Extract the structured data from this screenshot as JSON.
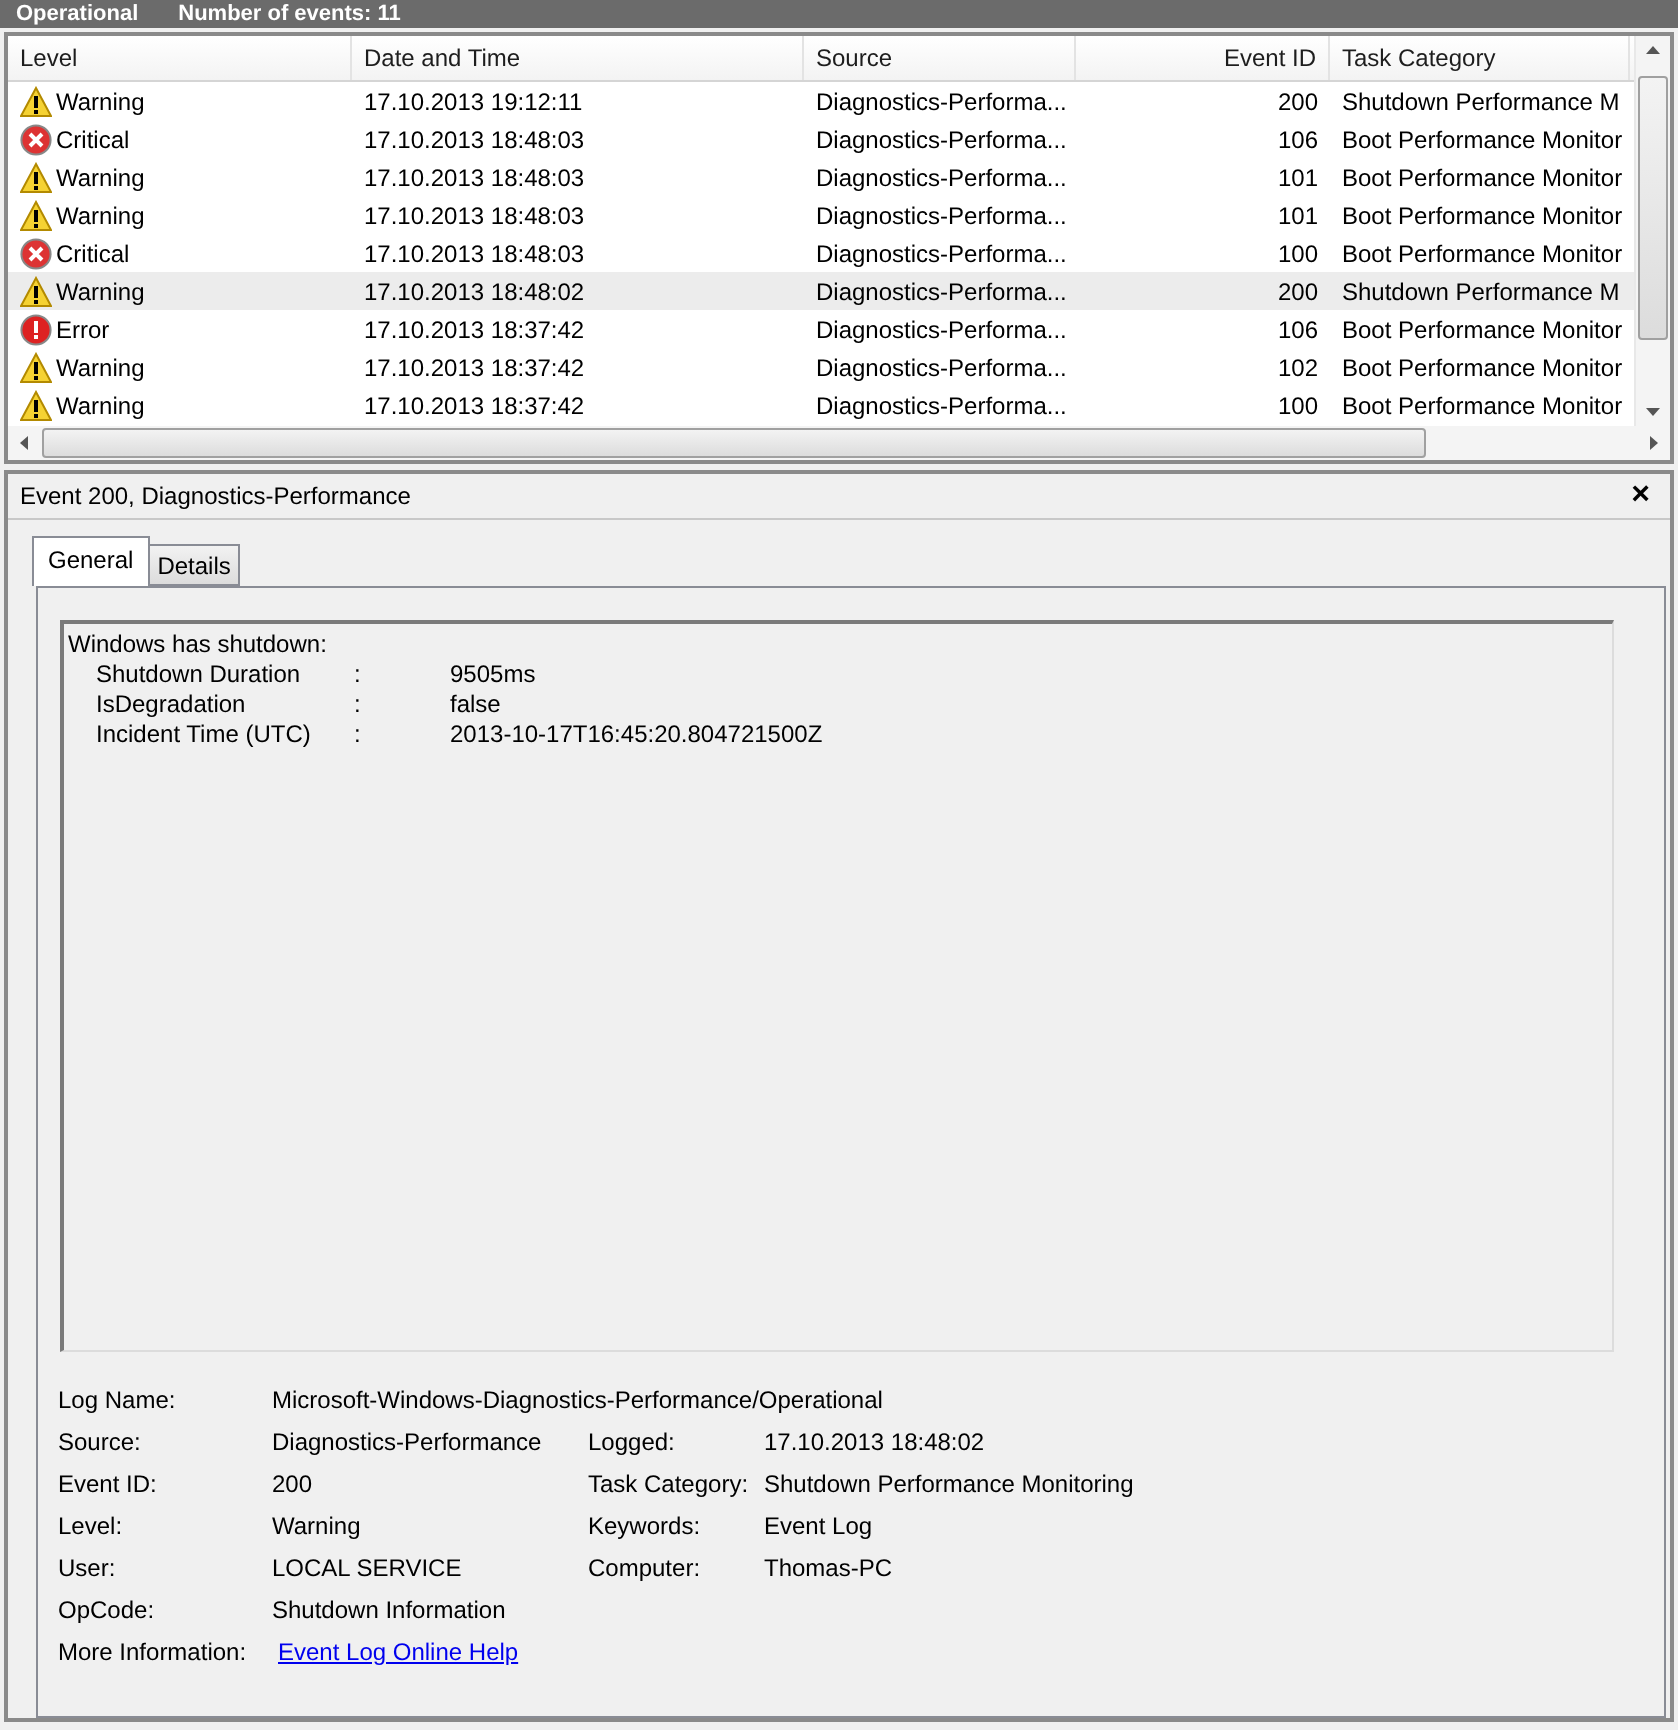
{
  "header": {
    "title": "Operational",
    "count": "Number of events: 11"
  },
  "table": {
    "columns": [
      {
        "label": "Level"
      },
      {
        "label": "Date and Time"
      },
      {
        "label": "Source"
      },
      {
        "label": "Event ID"
      },
      {
        "label": "Task Category"
      }
    ],
    "rows": [
      {
        "kind": "warning",
        "level": "Warning",
        "date": "17.10.2013 19:12:11",
        "source": "Diagnostics-Performa...",
        "id": "200",
        "task": "Shutdown Performance M",
        "selected": false
      },
      {
        "kind": "critical",
        "level": "Critical",
        "date": "17.10.2013 18:48:03",
        "source": "Diagnostics-Performa...",
        "id": "106",
        "task": "Boot Performance Monitor",
        "selected": false
      },
      {
        "kind": "warning",
        "level": "Warning",
        "date": "17.10.2013 18:48:03",
        "source": "Diagnostics-Performa...",
        "id": "101",
        "task": "Boot Performance Monitor",
        "selected": false
      },
      {
        "kind": "warning",
        "level": "Warning",
        "date": "17.10.2013 18:48:03",
        "source": "Diagnostics-Performa...",
        "id": "101",
        "task": "Boot Performance Monitor",
        "selected": false
      },
      {
        "kind": "critical",
        "level": "Critical",
        "date": "17.10.2013 18:48:03",
        "source": "Diagnostics-Performa...",
        "id": "100",
        "task": "Boot Performance Monitor",
        "selected": false
      },
      {
        "kind": "warning",
        "level": "Warning",
        "date": "17.10.2013 18:48:02",
        "source": "Diagnostics-Performa...",
        "id": "200",
        "task": "Shutdown Performance M",
        "selected": true
      },
      {
        "kind": "error",
        "level": "Error",
        "date": "17.10.2013 18:37:42",
        "source": "Diagnostics-Performa...",
        "id": "106",
        "task": "Boot Performance Monitor",
        "selected": false
      },
      {
        "kind": "warning",
        "level": "Warning",
        "date": "17.10.2013 18:37:42",
        "source": "Diagnostics-Performa...",
        "id": "102",
        "task": "Boot Performance Monitor",
        "selected": false
      },
      {
        "kind": "warning",
        "level": "Warning",
        "date": "17.10.2013 18:37:42",
        "source": "Diagnostics-Performa...",
        "id": "100",
        "task": "Boot Performance Monitor",
        "selected": false
      }
    ]
  },
  "detail": {
    "title": "Event 200, Diagnostics-Performance",
    "close": "×",
    "tabs": [
      {
        "label": "General",
        "selected": true
      },
      {
        "label": "Details",
        "selected": false
      }
    ],
    "message": {
      "heading": "Windows has shutdown:",
      "lines": [
        {
          "name": "Shutdown Duration",
          "sep": ":",
          "value": "9505ms"
        },
        {
          "name": "IsDegradation",
          "sep": ":",
          "value": "false"
        },
        {
          "name": "Incident Time (UTC)",
          "sep": ":",
          "value": "2013-10-17T16:45:20.804721500Z"
        }
      ]
    },
    "properties": [
      {
        "label": "Log Name:",
        "value": "Microsoft-Windows-Diagnostics-Performance/Operational"
      },
      {
        "label": "Source:",
        "value": "Diagnostics-Performance",
        "label2": "Logged:",
        "value2": "17.10.2013 18:48:02"
      },
      {
        "label": "Event ID:",
        "value": "200",
        "label2": "Task Category:",
        "value2": "Shutdown Performance Monitoring"
      },
      {
        "label": "Level:",
        "value": "Warning",
        "label2": "Keywords:",
        "value2": "Event Log"
      },
      {
        "label": "User:",
        "value": "LOCAL SERVICE",
        "label2": "Computer:",
        "value2": "Thomas-PC"
      },
      {
        "label": "OpCode:",
        "value": "Shutdown Information"
      },
      {
        "label": "More Information:",
        "link": "Event Log Online Help"
      }
    ]
  }
}
